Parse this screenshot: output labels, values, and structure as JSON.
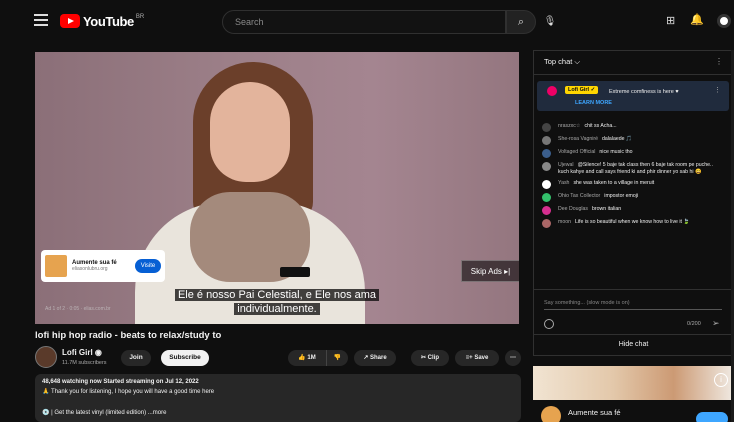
{
  "header": {
    "logo_text": "YouTube",
    "logo_cc": "BR",
    "search_placeholder": "Search"
  },
  "player": {
    "ad_card": {
      "title": "Aumente sua fé",
      "url": "eliasonlubru.org",
      "cta": "Visite"
    },
    "skip_label": "Skip Ads ▸|",
    "subtitle_line1": "Ele é nosso Pai Celestial, e Ele nos ama",
    "subtitle_line2": "individualmente.",
    "ad_status": "Ad 1 of 2 · 0:05 · elias.com.br"
  },
  "video": {
    "title": "lofi hip hop radio - beats to relax/study to",
    "channel_name": "Lofi Girl ◉",
    "channel_subs": "11.7M subscribers",
    "join_label": "Join",
    "subscribe_label": "Subscribe",
    "like_label": "👍 1M",
    "dislike_label": "👎",
    "share_label": "↗ Share",
    "clip_label": "✂ Clip",
    "save_label": "≡+ Save",
    "more_label": "⋯",
    "desc_line1": "48,648 watching now  Started streaming on Jul 12, 2022",
    "desc_line2": "🙏 Thank you for listening, I hope you will have a good time here",
    "desc_line3": "💿 | Get the latest vinyl (limited edition) ...more"
  },
  "chat": {
    "header_label": "Top chat ⌵",
    "pinned": {
      "name": "Lofi Girl ✓",
      "message": "Extreme comfiness is here ♥",
      "learn_more": "LEARN MORE"
    },
    "messages": [
      {
        "name": "nraszxc☆",
        "text": "chit ss Acha...",
        "color": "#444"
      },
      {
        "name": "She-rosa Vagniré",
        "text": "dalalaede 🎵",
        "color": "#777"
      },
      {
        "name": "Voltaged Official",
        "text": "nice music tho",
        "color": "#3b5e8c"
      },
      {
        "name": "Ujewal",
        "text": "@Silence! 5 baje tak class then 6 baje tak room pe puche.. kuch kahye and call says friend ki and phir dinner yo sab hi 😄",
        "color": "#888"
      },
      {
        "name": "Yash",
        "text": "she was taken to a village in meruit",
        "color": "#fff"
      },
      {
        "name": "Ohio Tax Collector",
        "text": "impostor emoji",
        "color": "#33c06b"
      },
      {
        "name": "Dee Douglas",
        "text": "brown italian",
        "color": "#d62f8f"
      },
      {
        "name": "moon",
        "text": "Life is so beautiful when we know how to live it 🍃",
        "color": "#a66"
      }
    ],
    "input_placeholder": "Say something... (slow mode is on)",
    "count": "0/200",
    "hide_chat": "Hide chat"
  },
  "side_ad": {
    "title": "Aumente sua fé",
    "info": "i"
  }
}
